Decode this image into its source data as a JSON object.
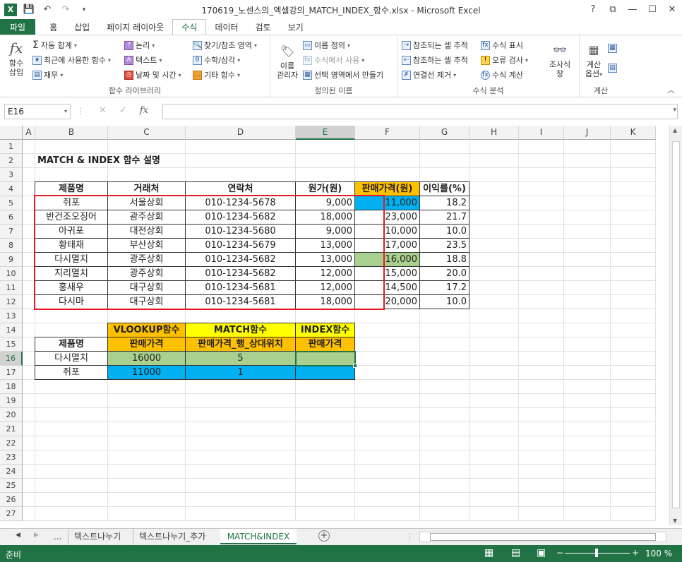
{
  "window": {
    "title": "170619_노센스의_엑셀강의_MATCH_INDEX_함수.xlsx - Microsoft Excel",
    "controls": [
      "?",
      "⧉",
      "—",
      "☐",
      "✕"
    ]
  },
  "tabs": [
    "파일",
    "홈",
    "삽입",
    "페이지 레이아웃",
    "수식",
    "데이터",
    "검토",
    "보기"
  ],
  "active_tab": "수식",
  "ribbon": {
    "group1": {
      "big_label1": "함수",
      "big_label2": "삽입",
      "items": [
        "자동 합계",
        "최근에 사용한 함수",
        "재무",
        "논리",
        "텍스트",
        "날짜 및 시간",
        "찾기/참조 영역",
        "수학/삼각",
        "기타 함수"
      ],
      "label": "함수 라이브러리"
    },
    "group2": {
      "big_label1": "이름",
      "big_label2": "관리자",
      "items": [
        "이름 정의",
        "수식에서 사용",
        "선택 영역에서 만들기"
      ],
      "label": "정의된 이름"
    },
    "group3": {
      "items": [
        "참조되는 셀 추적",
        "참조하는 셀 추적",
        "연결선 제거",
        "수식 표시",
        "오류 검사",
        "수식 계산"
      ],
      "big_label1": "조사식",
      "big_label2": "창",
      "label": "수식 분석"
    },
    "group4": {
      "big_label1": "계산",
      "big_label2": "옵션",
      "label": "계산"
    }
  },
  "formula_bar": {
    "name_box": "E16",
    "formula": ""
  },
  "columns": [
    "A",
    "B",
    "C",
    "D",
    "E",
    "F",
    "G",
    "H",
    "I",
    "J",
    "K"
  ],
  "rows": [
    "1",
    "2",
    "3",
    "4",
    "5",
    "6",
    "7",
    "8",
    "9",
    "10",
    "11",
    "12",
    "13",
    "14",
    "15",
    "16",
    "17",
    "18",
    "19",
    "20",
    "21",
    "22",
    "23",
    "24",
    "25",
    "26",
    "27"
  ],
  "sheet": {
    "title": "MATCH & INDEX 함수 설명",
    "headers": [
      "제품명",
      "거래처",
      "연락처",
      "원가(원)",
      "판매가격(원)",
      "이익률(%)"
    ],
    "data": [
      [
        "쥐포",
        "서울상회",
        "010-1234-5678",
        "9,000",
        "11,000",
        "18.2"
      ],
      [
        "반건조오징어",
        "광주상회",
        "010-1234-5682",
        "18,000",
        "23,000",
        "21.7"
      ],
      [
        "아귀포",
        "대전상회",
        "010-1234-5680",
        "9,000",
        "10,000",
        "10.0"
      ],
      [
        "황태채",
        "부산상회",
        "010-1234-5679",
        "13,000",
        "17,000",
        "23.5"
      ],
      [
        "다시멸치",
        "광주상회",
        "010-1234-5682",
        "13,000",
        "16,000",
        "18.8"
      ],
      [
        "지리멸치",
        "광주상회",
        "010-1234-5682",
        "12,000",
        "15,000",
        "20.0"
      ],
      [
        "홍새우",
        "대구상회",
        "010-1234-5681",
        "12,000",
        "14,500",
        "17.2"
      ],
      [
        "다시마",
        "대구상회",
        "010-1234-5681",
        "18,000",
        "20,000",
        "10.0"
      ]
    ],
    "table2": {
      "top_headers": [
        "VLOOKUP함수",
        "MATCH함수",
        "INDEX함수"
      ],
      "sub_headers": [
        "제품명",
        "판매가격",
        "판매가격_행_상대위치",
        "판매가격"
      ],
      "rows": [
        [
          "다시멸치",
          "16000",
          "5",
          ""
        ],
        [
          "쥐포",
          "11000",
          "1",
          ""
        ]
      ]
    }
  },
  "sheet_tabs": [
    "...",
    "텍스트나누기",
    "텍스트나누기_추가",
    "MATCH&INDEX"
  ],
  "active_sheet": "MATCH&INDEX",
  "status": {
    "mode": "준비",
    "zoom": "100 %"
  },
  "colors": {
    "excel_green": "#217346",
    "orange_header": "#ffc000",
    "yellow_header": "#ffff00",
    "blue_fill": "#00b0f0",
    "green_fill": "#a9d08e",
    "red_border": "#e41b23"
  }
}
